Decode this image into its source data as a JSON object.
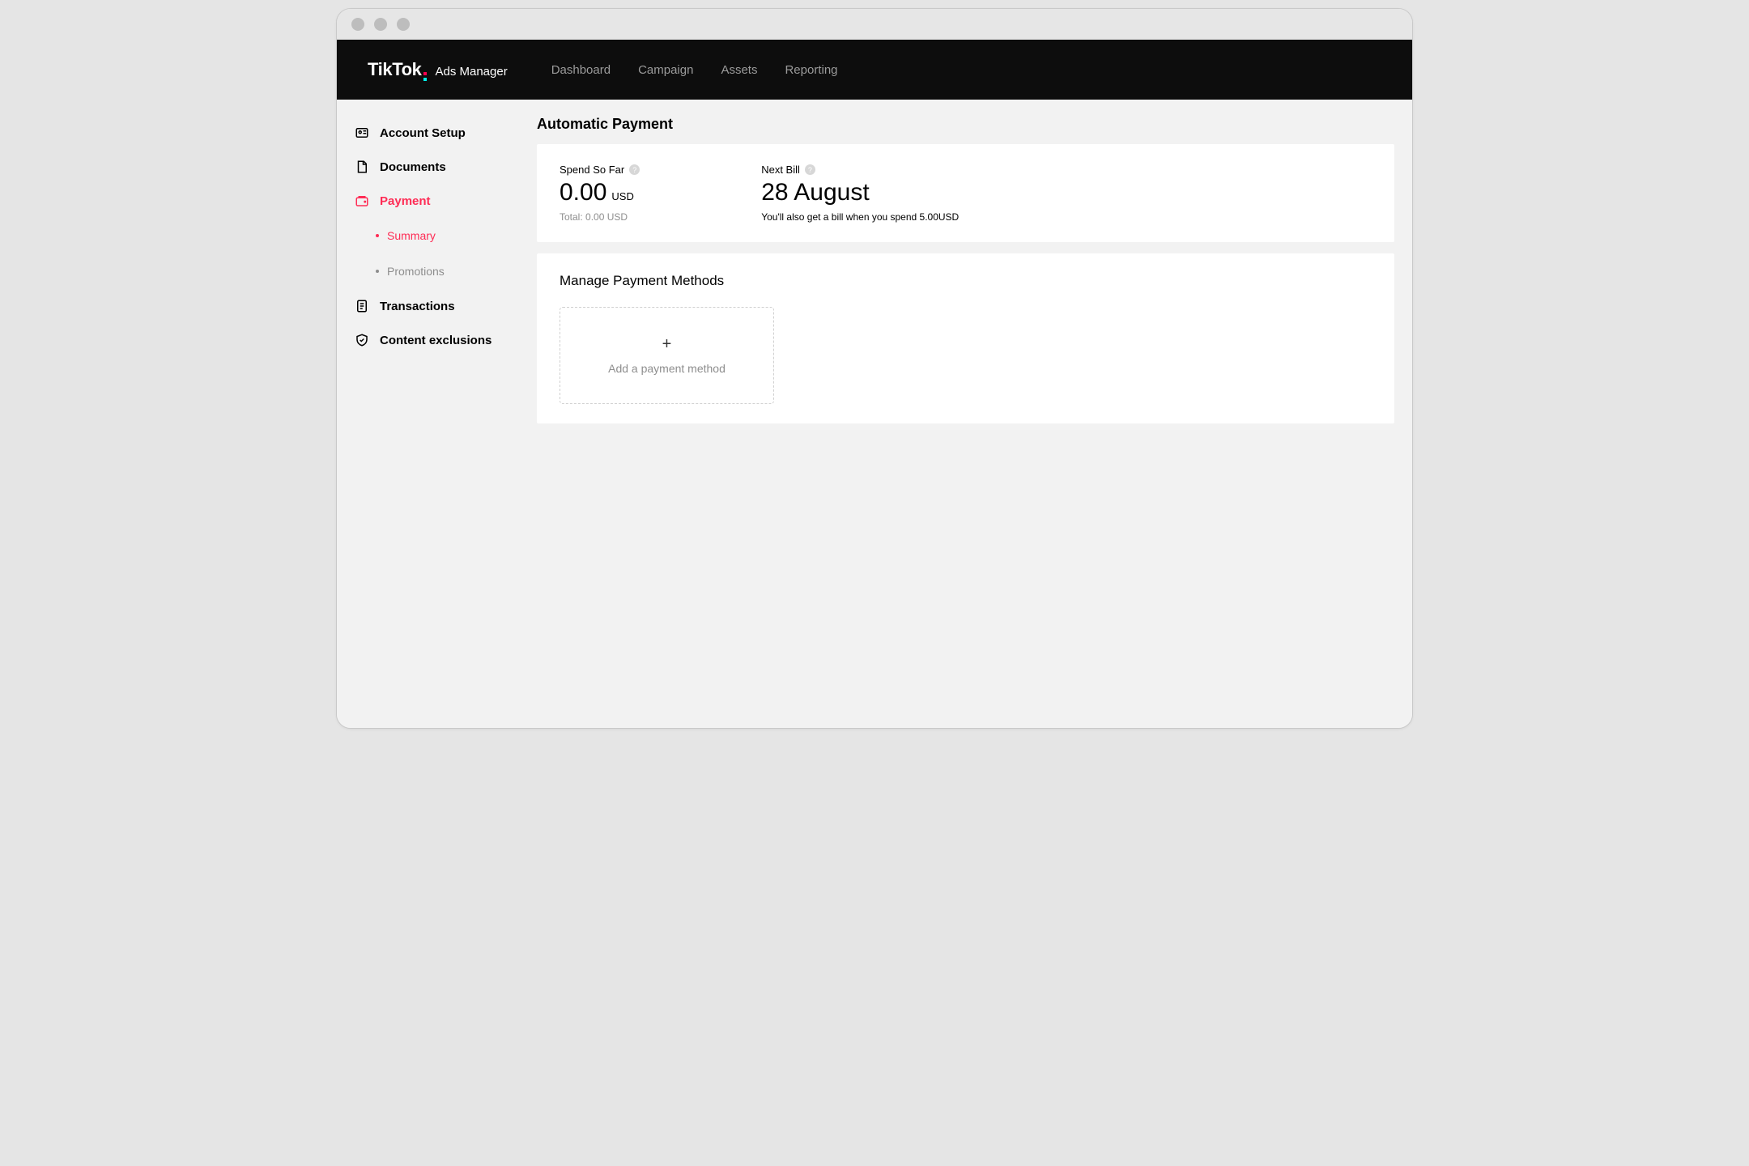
{
  "app": {
    "logo_main": "TikTok",
    "logo_sub": "Ads Manager"
  },
  "nav": {
    "items": [
      {
        "label": "Dashboard"
      },
      {
        "label": "Campaign"
      },
      {
        "label": "Assets"
      },
      {
        "label": "Reporting"
      }
    ]
  },
  "sidebar": {
    "items": [
      {
        "label": "Account Setup"
      },
      {
        "label": "Documents"
      },
      {
        "label": "Payment"
      },
      {
        "label": "Transactions"
      },
      {
        "label": "Content exclusions"
      }
    ],
    "sub": [
      {
        "label": "Summary"
      },
      {
        "label": "Promotions"
      }
    ]
  },
  "main": {
    "title": "Automatic Payment",
    "spend": {
      "label": "Spend So Far",
      "value": "0.00",
      "currency": "USD",
      "total_label": "Total: 0.00 USD"
    },
    "next_bill": {
      "label": "Next Bill",
      "value": "28 August",
      "note": "You'll also get a bill when you spend 5.00USD"
    },
    "methods": {
      "title": "Manage Payment Methods",
      "add_label": "Add a payment method"
    }
  }
}
